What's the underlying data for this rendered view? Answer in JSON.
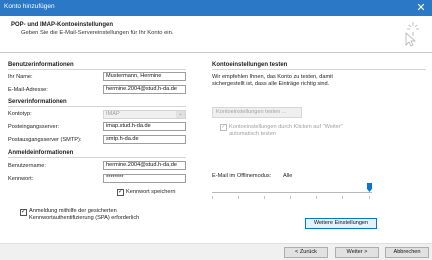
{
  "window": {
    "title": "Konto hinzufügen",
    "close_glyph": "✕"
  },
  "header": {
    "title": "POP- und IMAP-Kontoeinstellungen",
    "subtitle": "Geben Sie die E-Mail-Servereinstellungen für Ihr Konto ein."
  },
  "benutzer": {
    "heading": "Benutzerinformationen",
    "name_label": "Ihr Name:",
    "name_value": "Mustermann, Hermine",
    "email_label": "E-Mail-Adresse:",
    "email_value": "hermine.2004@stud.h-da.de"
  },
  "server": {
    "heading": "Serverinformationen",
    "type_label": "Kontotyp:",
    "type_value": "IMAP",
    "incoming_label": "Posteingangsserver:",
    "incoming_value": "imap.stud.h-da.de",
    "outgoing_label": "Postausgangsserver (SMTP):",
    "outgoing_value": "smtp.h-da.de"
  },
  "login": {
    "heading": "Anmeldeinformationen",
    "user_label": "Benutzername:",
    "user_value": "hermine.2004@stud.h-da.de",
    "password_label": "Kennwort:",
    "password_value": "********",
    "remember_label": "Kennwort speichern",
    "remember_checked": true,
    "spa_label_line1": "Anmeldung mithilfe der gesicherten",
    "spa_label_line2": "Kennwortauthentifizierung (SPA) erforderlich",
    "spa_checked": true
  },
  "test": {
    "heading": "Kontoeinstellungen testen",
    "description_line1": "Wir empfehlen Ihnen, das Konto zu testen, damit",
    "description_line2": "sichergestellt ist, dass alle Einträge richtig sind.",
    "test_button": "Kontoeinstellungen testen ...",
    "auto_test_line1": "Kontoeinstellungen durch Klicken auf \"Weiter\"",
    "auto_test_line2": "automatisch testen",
    "auto_test_checked": true
  },
  "offline": {
    "label": "E-Mail im Offlinemodus:",
    "value": "Alle",
    "slider_fraction": 1.0
  },
  "more_settings_button": "Weitere Einstellungen",
  "footer": {
    "back": "< Zurück",
    "next": "Weiter >",
    "cancel": "Abbrechen"
  },
  "colors": {
    "titlebar": "#2b78c6",
    "accent": "#0078d7"
  }
}
